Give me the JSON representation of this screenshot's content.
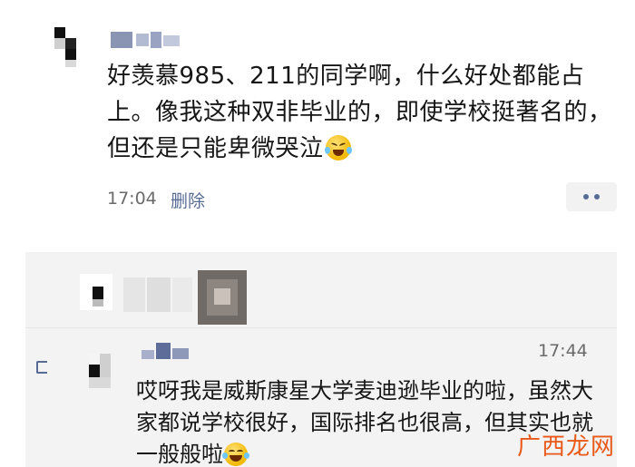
{
  "post": {
    "text": "好羡慕985、211的同学啊，什么好处都能占上。像我这种双非毕业的，即使学校挺著名的，但还是只能卑微哭泣",
    "emoji": "crying-face-emoji",
    "time": "17:04",
    "delete_label": "删除"
  },
  "comment": {
    "time": "17:44",
    "text": "哎呀我是威斯康星大学麦迪逊毕业的啦，虽然大家都说学校很好，国际排名也很高，但其实也就一般般啦",
    "emoji": "laughing-tears-emoji"
  },
  "watermark": {
    "text": "广西龙网"
  },
  "colors": {
    "link": "#576b95",
    "comment_bg": "#f3f3f3",
    "watermark": "#e8591a"
  }
}
